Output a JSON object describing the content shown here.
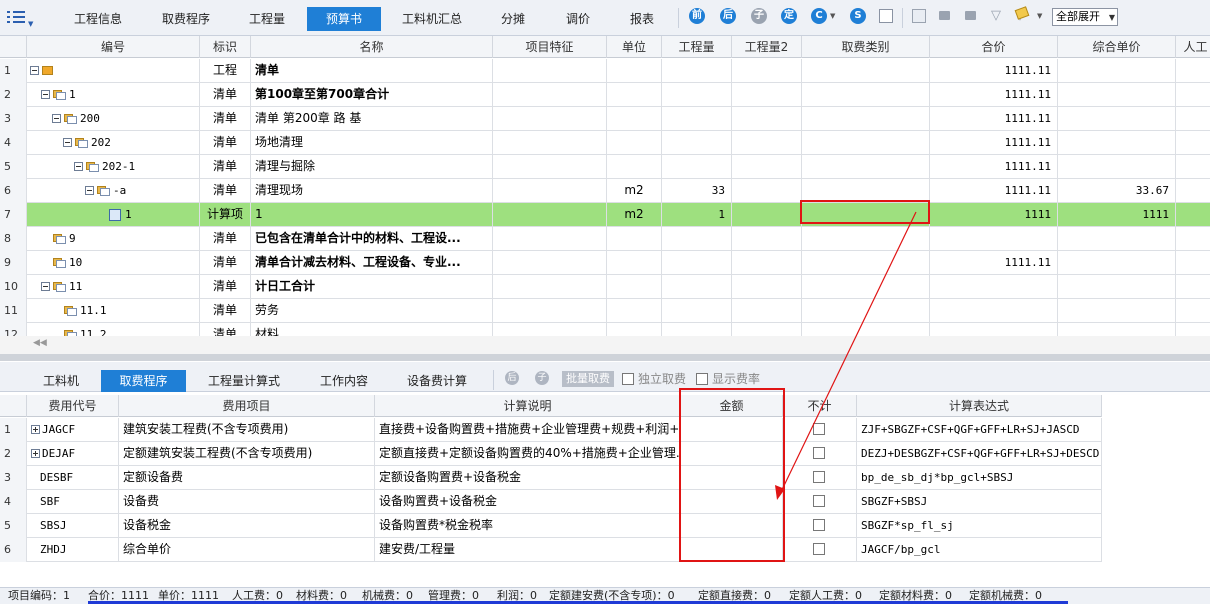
{
  "top_tabs": [
    "工程信息",
    "取费程序",
    "工程量",
    "预算书",
    "工料机汇总",
    "分摊",
    "调价",
    "报表"
  ],
  "active_top_tab": "预算书",
  "toolbar": {
    "expand_select": "全部展开",
    "icons": [
      "refresh-icon",
      "recalc-icon",
      "price-icon",
      "quota-icon",
      "c-icon",
      "s-icon",
      "doc-icon",
      "import-icon",
      "lock-icon",
      "unlock-icon",
      "filter-icon",
      "filter-clear-icon",
      "paint-icon"
    ],
    "colors": {
      "blue": "#1f7fd6",
      "grey": "#9aa3b0"
    }
  },
  "grid": {
    "columns": [
      "编号",
      "标识",
      "名称",
      "项目特征",
      "单位",
      "工程量",
      "工程量2",
      "取费类别",
      "合价",
      "综合单价",
      "人工"
    ],
    "rows": [
      {
        "n": "1",
        "code": "",
        "tag": "工程",
        "name": "清单",
        "unit": "",
        "qty": "",
        "total": "1111.11",
        "unit_price": "",
        "bold": true
      },
      {
        "n": "2",
        "code": "1",
        "tag": "清单",
        "name": "第100章至第700章合计",
        "unit": "",
        "qty": "",
        "total": "1111.11",
        "unit_price": "",
        "bold": true
      },
      {
        "n": "3",
        "code": "200",
        "tag": "清单",
        "name": "清单  第200章  路 基",
        "unit": "",
        "qty": "",
        "total": "1111.11",
        "unit_price": "",
        "bold": false
      },
      {
        "n": "4",
        "code": "202",
        "tag": "清单",
        "name": "场地清理",
        "unit": "",
        "qty": "",
        "total": "1111.11",
        "unit_price": "",
        "bold": false
      },
      {
        "n": "5",
        "code": "202-1",
        "tag": "清单",
        "name": "清理与掘除",
        "unit": "",
        "qty": "",
        "total": "1111.11",
        "unit_price": "",
        "bold": false
      },
      {
        "n": "6",
        "code": "-a",
        "tag": "清单",
        "name": "清理现场",
        "unit": "m2",
        "qty": "33",
        "total": "1111.11",
        "unit_price": "33.67",
        "bold": false
      },
      {
        "n": "7",
        "code": "1",
        "tag": "计算项",
        "name": "1",
        "unit": "m2",
        "qty": "1",
        "total": "1111",
        "unit_price": "1111",
        "bold": false
      },
      {
        "n": "8",
        "code": "9",
        "tag": "清单",
        "name": "已包含在清单合计中的材料、工程设...",
        "unit": "",
        "qty": "",
        "total": "",
        "unit_price": "",
        "bold": true
      },
      {
        "n": "9",
        "code": "10",
        "tag": "清单",
        "name": "清单合计减去材料、工程设备、专业...",
        "unit": "",
        "qty": "",
        "total": "1111.11",
        "unit_price": "",
        "bold": true
      },
      {
        "n": "10",
        "code": "11",
        "tag": "清单",
        "name": "计日工合计",
        "unit": "",
        "qty": "",
        "total": "",
        "unit_price": "",
        "bold": true
      },
      {
        "n": "11",
        "code": "11.1",
        "tag": "清单",
        "name": "劳务",
        "unit": "",
        "qty": "",
        "total": "",
        "unit_price": "",
        "bold": false
      },
      {
        "n": "12",
        "code": "11.2",
        "tag": "清单",
        "name": "材料",
        "unit": "",
        "qty": "",
        "total": "",
        "unit_price": "",
        "bold": false
      }
    ]
  },
  "lower_tabs": [
    "工料机",
    "取费程序",
    "工程量计算式",
    "工作内容",
    "设备费计算"
  ],
  "active_lower_tab": "取费程序",
  "lower_toolbar": {
    "batch_button": "批量取费",
    "independent_fee": "独立取费",
    "show_rate": "显示费率"
  },
  "fee_table": {
    "columns": [
      "费用代号",
      "费用项目",
      "计算说明",
      "金额",
      "不计",
      "计算表达式"
    ],
    "rows": [
      {
        "n": "1",
        "code": "JAGCF",
        "item": "建筑安装工程费(不含专项费用)",
        "desc": "直接费+设备购置费+措施费+企业管理费+规费+利润+...",
        "amount": "",
        "expr": "ZJF+SBGZF+CSF+QGF+GFF+LR+SJ+JASCD",
        "expandable": true
      },
      {
        "n": "2",
        "code": "DEJAF",
        "item": "定额建筑安装工程费(不含专项费用)",
        "desc": "定额直接费+定额设备购置费的40%+措施费+企业管理...",
        "amount": "",
        "expr": "DEZJ+DESBGZF+CSF+QGF+GFF+LR+SJ+DESCD...",
        "expandable": true
      },
      {
        "n": "3",
        "code": "DESBF",
        "item": "定额设备费",
        "desc": "定额设备购置费+设备税金",
        "amount": "",
        "expr": "bp_de_sb_dj*bp_gcl+SBSJ",
        "expandable": false
      },
      {
        "n": "4",
        "code": "SBF",
        "item": "设备费",
        "desc": "设备购置费+设备税金",
        "amount": "",
        "expr": "SBGZF+SBSJ",
        "expandable": false
      },
      {
        "n": "5",
        "code": "SBSJ",
        "item": "设备税金",
        "desc": "设备购置费*税金税率",
        "amount": "",
        "expr": "SBGZF*sp_fl_sj",
        "expandable": false
      },
      {
        "n": "6",
        "code": "ZHDJ",
        "item": "综合单价",
        "desc": "建安费/工程量",
        "amount": "",
        "expr": "JAGCF/bp_gcl",
        "expandable": false
      }
    ]
  },
  "status": [
    "项目编码：1",
    "合价：1111",
    "单价：1111",
    "人工费：0",
    "材料费：0",
    "机械费：0",
    "管理费：0",
    "利润：0",
    "定额建安费(不含专项)：0",
    "定额直接费：0",
    "定额人工费：0",
    "定额材料费：0",
    "定额机械费：0"
  ],
  "annotation_color": "#e01414"
}
